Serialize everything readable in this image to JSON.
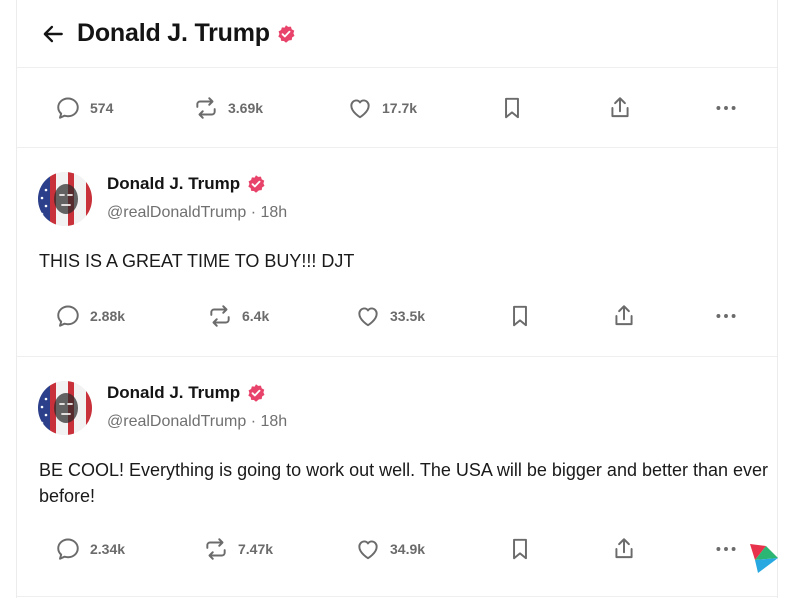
{
  "header": {
    "title": "Donald J. Trump"
  },
  "top_post_actions": {
    "replies": "574",
    "reposts": "3.69k",
    "likes": "17.7k"
  },
  "posts": [
    {
      "author": "Donald J. Trump",
      "meta": "@realDonaldTrump · 18h",
      "text": "THIS IS A GREAT TIME TO BUY!!! DJT",
      "replies": "2.88k",
      "reposts": "6.4k",
      "likes": "33.5k"
    },
    {
      "author": "Donald J. Trump",
      "meta": "@realDonaldTrump · 18h",
      "text": "BE COOL! Everything is going to work out well. The USA will be bigger and better than ever before!",
      "replies": "2.34k",
      "reposts": "7.47k",
      "likes": "34.9k"
    }
  ],
  "colors": {
    "verified": "#e8436a",
    "icon": "#6b6b6b",
    "divider": "#efefef"
  },
  "icons": [
    "back-arrow-icon",
    "verified-badge-icon",
    "reply-icon",
    "repost-icon",
    "like-icon",
    "bookmark-icon",
    "share-icon",
    "more-icon"
  ]
}
